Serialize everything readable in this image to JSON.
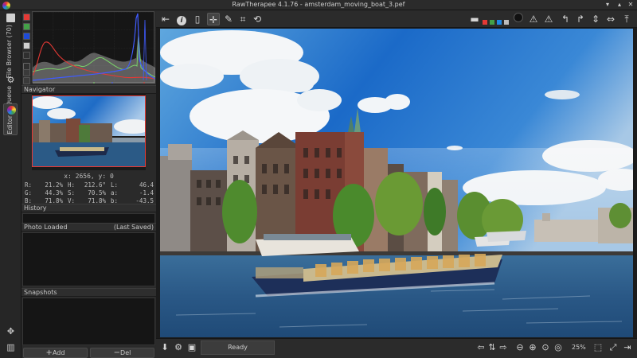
{
  "window": {
    "title": "RawTherapee 4.1.76 - amsterdam_moving_boat_3.pef"
  },
  "vertical_tabs": {
    "file_browser": "File Browser (70)",
    "queue": "Queue",
    "editor": "Editor"
  },
  "navigator": {
    "label": "Navigator",
    "coords": "x: 2656, y: 0",
    "readouts": [
      [
        {
          "k": "R:",
          "v": "21.2%"
        },
        {
          "k": "H:",
          "v": "212.6°"
        },
        {
          "k": "L:",
          "v": "46.4"
        }
      ],
      [
        {
          "k": "G:",
          "v": "44.3%"
        },
        {
          "k": "S:",
          "v": "70.5%"
        },
        {
          "k": "a:",
          "v": "-1.4"
        }
      ],
      [
        {
          "k": "B:",
          "v": "71.8%"
        },
        {
          "k": "V:",
          "v": "71.8%"
        },
        {
          "k": "b:",
          "v": "-43.5"
        }
      ]
    ]
  },
  "history": {
    "label": "History",
    "col_photo": "Photo Loaded",
    "col_saved": "(Last Saved)"
  },
  "snapshots": {
    "label": "Snapshots",
    "add_label": "Add",
    "del_label": "Del"
  },
  "statusbar": {
    "ready_label": "Ready",
    "zoom": "25%"
  },
  "colors": {
    "histogram_red": "#e53935",
    "histogram_green": "#7bd36a",
    "histogram_blue": "#3f5bff",
    "accent_orange": "#e0a030"
  }
}
